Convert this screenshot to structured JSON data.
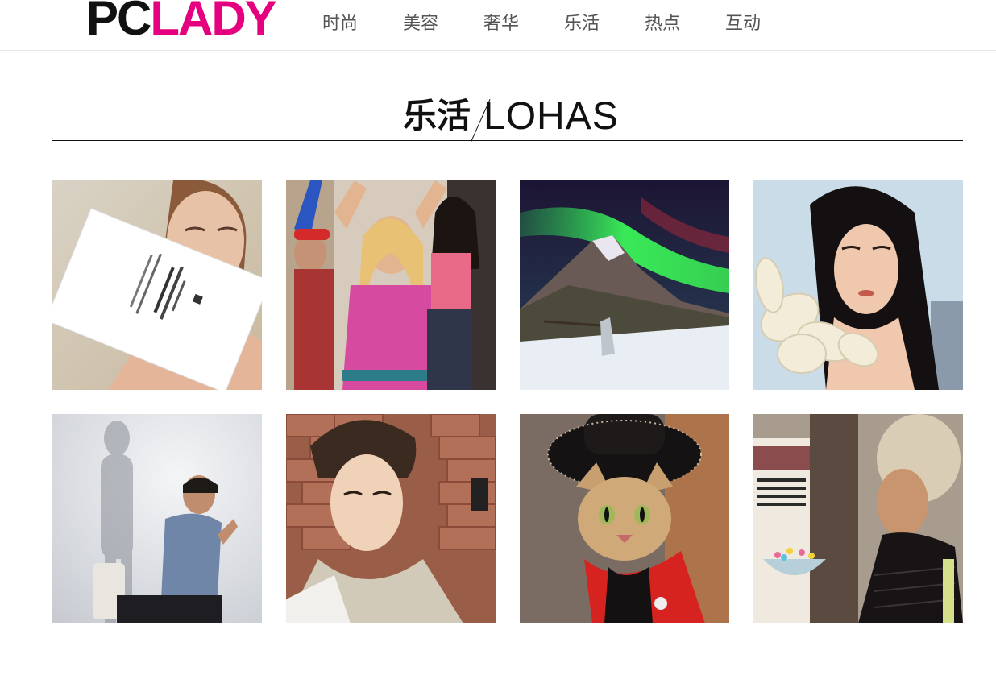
{
  "logo": {
    "part1": "PC",
    "part2": "LADY"
  },
  "nav": [
    "时尚",
    "美容",
    "奢华",
    "乐活",
    "热点",
    "互动"
  ],
  "section": {
    "title_cn": "乐活",
    "title_en": "LOHAS"
  },
  "tiles": [
    {
      "icon": "woman-with-card-photo"
    },
    {
      "icon": "cheering-friends-photo"
    },
    {
      "icon": "aurora-mountain-photo"
    },
    {
      "icon": "woman-with-flower-photo"
    },
    {
      "icon": "thinking-man-photo"
    },
    {
      "icon": "young-man-portrait-photo"
    },
    {
      "icon": "cat-in-hat-photo"
    },
    {
      "icon": "woman-with-bowl-photo"
    }
  ],
  "colors": {
    "brand_pink": "#e4007f",
    "text_dark": "#111111",
    "nav_text": "#555555"
  }
}
